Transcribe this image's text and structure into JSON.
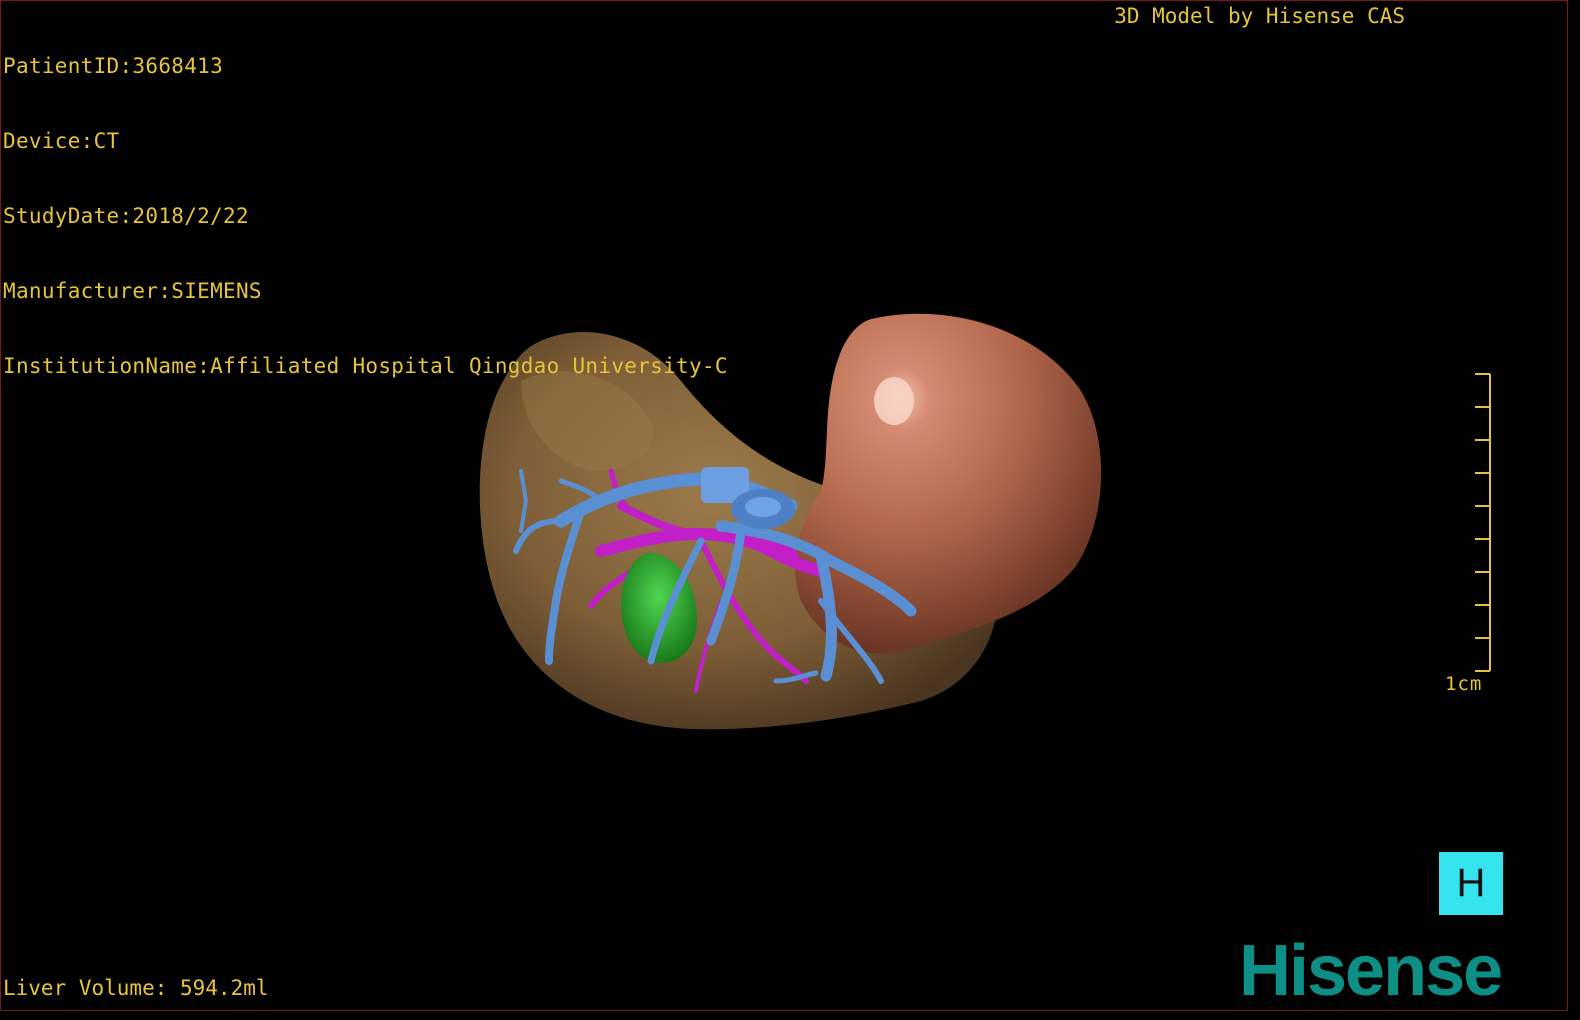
{
  "patient_info": {
    "patient_id": "PatientID:3668413",
    "device": "Device:CT",
    "study_date": "StudyDate:2018/2/22",
    "manufacturer": "Manufacturer:SIEMENS",
    "institution": "InstitutionName:Affiliated Hospital Qingdao University-C"
  },
  "model_credit": "3D Model by Hisense CAS",
  "liver_volume": "Liver Volume: 594.2ml",
  "scale": {
    "label": "1cm"
  },
  "orientation": {
    "label": "H"
  },
  "brand": {
    "logo_text": "Hisense"
  },
  "colors": {
    "overlay_text": "#e6c43a",
    "liver": "#8a6a40",
    "spleen_or_kidney": "#b86a4c",
    "portal_vein": "#5b8fd4",
    "hepatic_artery": "#c21fc9",
    "tumor": "#2fb52f",
    "orientation_cube": "#36e4f0",
    "brand": "#0e8f86"
  }
}
